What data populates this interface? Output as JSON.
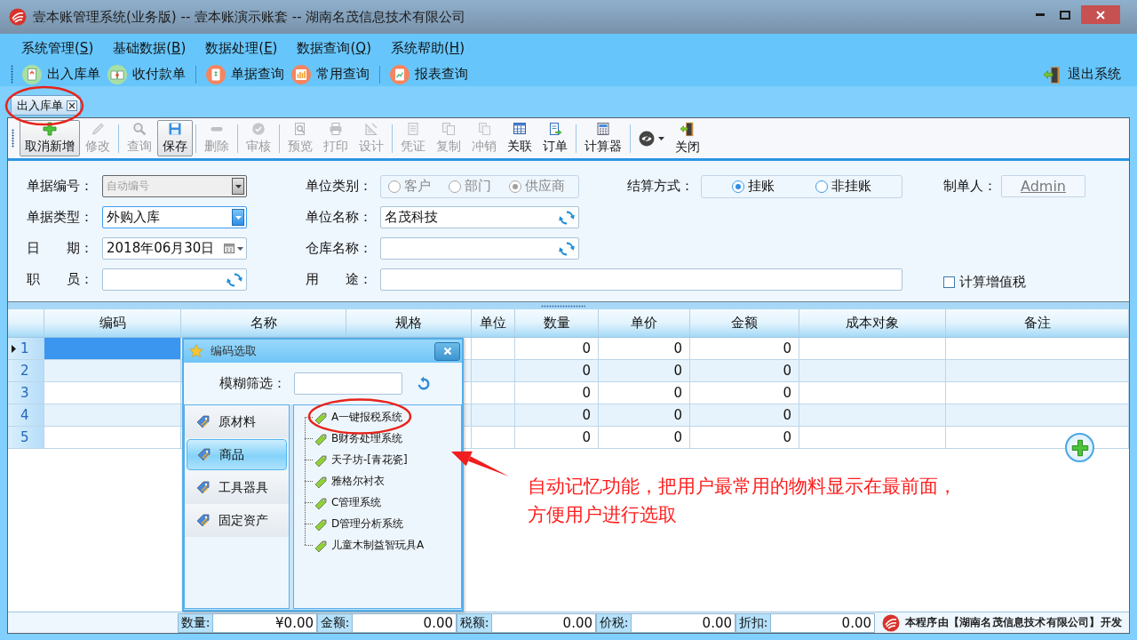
{
  "window": {
    "title": "壹本账管理系统(业务版) -- 壹本账演示账套 -- 湖南名茂信息技术有限公司"
  },
  "menu": [
    {
      "before": "系统管理(",
      "key": "S",
      "after": ")"
    },
    {
      "before": "基础数据(",
      "key": "B",
      "after": ")"
    },
    {
      "before": "数据处理(",
      "key": "E",
      "after": ")"
    },
    {
      "before": "数据查询(",
      "key": "Q",
      "after": ")"
    },
    {
      "before": "系统帮助(",
      "key": "H",
      "after": ")"
    }
  ],
  "quickbar": {
    "groups": [
      [
        {
          "label": "出入库单"
        },
        {
          "label": "收付款单"
        }
      ],
      [
        {
          "label": "单据查询"
        },
        {
          "label": "常用查询"
        }
      ],
      [
        {
          "label": "报表查询"
        }
      ]
    ],
    "exit": "退出系统"
  },
  "doc_tabs": [
    {
      "label": "出入库单",
      "selected": true
    }
  ],
  "toolbar": [
    [
      {
        "kind": "button",
        "label": "取消新增",
        "disabled": false,
        "pressed": true
      },
      {
        "kind": "button",
        "label": "修改",
        "disabled": true,
        "pressed": false
      }
    ],
    [
      {
        "kind": "button",
        "label": "查询",
        "disabled": true,
        "pressed": false
      },
      {
        "kind": "button",
        "label": "保存",
        "disabled": false,
        "pressed": true
      }
    ],
    [
      {
        "kind": "button",
        "label": "删除",
        "disabled": true,
        "pressed": false
      }
    ],
    [
      {
        "kind": "button",
        "label": "审核",
        "disabled": true,
        "pressed": false
      }
    ],
    [
      {
        "kind": "button",
        "label": "预览",
        "disabled": true,
        "pressed": false
      },
      {
        "kind": "button",
        "label": "打印",
        "disabled": true,
        "pressed": false
      },
      {
        "kind": "button",
        "label": "设计",
        "disabled": true,
        "pressed": false
      }
    ],
    [
      {
        "kind": "button",
        "label": "凭证",
        "disabled": true,
        "pressed": false
      },
      {
        "kind": "button",
        "label": "复制",
        "disabled": true,
        "pressed": false
      },
      {
        "kind": "button",
        "label": "冲销",
        "disabled": true,
        "pressed": false
      },
      {
        "kind": "button",
        "label": "关联",
        "disabled": false,
        "pressed": false
      },
      {
        "kind": "button",
        "label": "订单",
        "disabled": false,
        "pressed": false
      }
    ],
    [
      {
        "kind": "button",
        "label": "计算器",
        "disabled": false,
        "pressed": false
      }
    ],
    [
      {
        "kind": "dropdown",
        "disabled": false,
        "pressed": false
      },
      {
        "kind": "button",
        "label": "关闭",
        "disabled": false,
        "pressed": false
      }
    ]
  ],
  "form": {
    "doc_no": {
      "label": "单据编号：",
      "placeholder": "自动编号",
      "disabled": true
    },
    "unit_type": {
      "label": "单位类别：",
      "disabled": true,
      "options": [
        {
          "label": "客户",
          "selected": false
        },
        {
          "label": "部门",
          "selected": false
        },
        {
          "label": "供应商",
          "selected": true
        }
      ]
    },
    "settlement": {
      "label": "结算方式：",
      "disabled": false,
      "options": [
        {
          "label": "挂账",
          "selected": true
        },
        {
          "label": "非挂账",
          "selected": false
        }
      ]
    },
    "maker": {
      "label": "制单人：",
      "value": "Admin"
    },
    "doc_type": {
      "label": "单据类型：",
      "value": "外购入库",
      "focused": true
    },
    "unit_name": {
      "label": "单位名称：",
      "value": "名茂科技"
    },
    "date": {
      "label": "日　　期：",
      "value": "2018年06月30日"
    },
    "warehouse": {
      "label": "仓库名称："
    },
    "clerk": {
      "label": "职　　员："
    },
    "purpose": {
      "label": "用　　途："
    },
    "vat": {
      "label": "计算增值税",
      "checked": false
    }
  },
  "grid": {
    "columns": [
      "编码",
      "名称",
      "规格",
      "单位",
      "数量",
      "单价",
      "金额",
      "成本对象",
      "备注"
    ],
    "rows": [
      {
        "number": "1",
        "selected": true,
        "quantity": "0",
        "unit_price": "0",
        "amount": "0"
      },
      {
        "number": "2",
        "selected": false,
        "quantity": "0",
        "unit_price": "0",
        "amount": "0"
      },
      {
        "number": "3",
        "selected": false,
        "quantity": "0",
        "unit_price": "0",
        "amount": "0"
      },
      {
        "number": "4",
        "selected": false,
        "quantity": "0",
        "unit_price": "0",
        "amount": "0"
      },
      {
        "number": "5",
        "selected": false,
        "quantity": "0",
        "unit_price": "0",
        "amount": "0"
      }
    ]
  },
  "picker": {
    "title": "编码选取",
    "filter_label": "模糊筛选：",
    "categories": [
      {
        "label": "原材料",
        "selected": false
      },
      {
        "label": "商品",
        "selected": true
      },
      {
        "label": "工具器具",
        "selected": false
      },
      {
        "label": "固定资产",
        "selected": false
      }
    ],
    "items": [
      "A一键报税系统",
      "B财务处理系统",
      "天子坊-[青花瓷]",
      "雅格尔衬衣",
      "C管理系统",
      "D管理分析系统",
      "儿童木制益智玩具A"
    ]
  },
  "totals": [
    {
      "label": "数量:",
      "value": "¥0.00"
    },
    {
      "label": "金额:",
      "value": "0.00"
    },
    {
      "label": "税额:",
      "value": "0.00"
    },
    {
      "label": "价税:",
      "value": "0.00"
    },
    {
      "label": "折扣:",
      "value": "0.00"
    }
  ],
  "credit": "本程序由【湖南名茂信息技术有限公司】开发",
  "annotation": {
    "lines": [
      "自动记忆功能，把用户最常用的物料显示在最前面，",
      "方便用户进行选取"
    ]
  }
}
